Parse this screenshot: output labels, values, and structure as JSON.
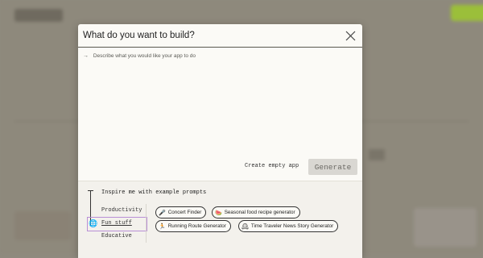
{
  "modal": {
    "title": "What do you want to build?",
    "prompt_placeholder": "Describe what you would like your app to do",
    "create_empty_label": "Create empty app",
    "generate_label": "Generate"
  },
  "inspire": {
    "label": "Inspire me with example prompts",
    "categories": [
      "Productivity",
      "Fun stuff",
      "Educative"
    ],
    "selected_category": "Fun stuff",
    "prompts": [
      {
        "icon": "microphone-icon",
        "label": "Concert Finder"
      },
      {
        "icon": "food-icon",
        "label": "Seasonal food recipe generator"
      },
      {
        "icon": "runner-icon",
        "label": "Running Route Generator"
      },
      {
        "icon": "clock-icon",
        "label": "Time Traveler News Story Generator"
      }
    ]
  },
  "colors": {
    "accent_outline": "#b98fd6",
    "generate_bg": "#d9d7d2",
    "modal_bg": "#fbfaf6"
  }
}
